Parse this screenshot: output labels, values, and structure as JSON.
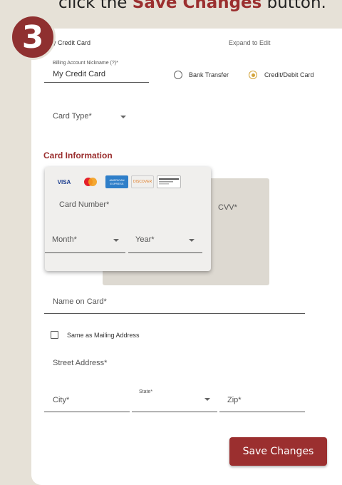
{
  "instruction": {
    "pre": "click the ",
    "highlight": "Save Changes",
    "post": " button."
  },
  "step_number": "3",
  "header": {
    "account_title": "y Credit Card",
    "expand_link": "Expand to Edit"
  },
  "nickname": {
    "label": "Billing Account Nickname (?)*",
    "value": "My Credit Card"
  },
  "payment_method": {
    "options": [
      "Bank Transfer",
      "Credit/Debit Card"
    ],
    "selected": "Credit/Debit Card"
  },
  "card_type": {
    "label": "Card Type*"
  },
  "card_info": {
    "title": "Card Information",
    "logos": [
      "VISA",
      "MC",
      "AMERICAN EXPRESS",
      "DISCOVER",
      "GENERIC"
    ],
    "card_number_label": "Card Number*",
    "month_label": "Month*",
    "year_label": "Year*",
    "cvv_label": "CVV*"
  },
  "name_on_card": {
    "label": "Name on Card*"
  },
  "same_as_mailing": {
    "label": "Same as Mailing Address",
    "checked": false
  },
  "street": {
    "label": "Street Address*"
  },
  "city": {
    "label": "City*"
  },
  "state": {
    "label": "State*"
  },
  "zip": {
    "label": "Zip*"
  },
  "save_button": {
    "label": "Save Changes"
  },
  "colors": {
    "accent": "#9b2f2f",
    "background": "#e6e1d7",
    "radio_selected": "#d3a43a"
  }
}
